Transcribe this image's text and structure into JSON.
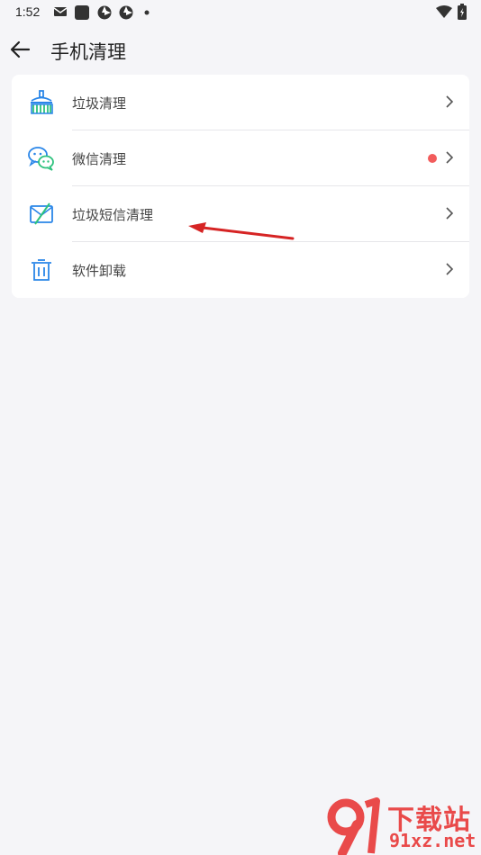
{
  "status_bar": {
    "time": "1:52"
  },
  "header": {
    "title": "手机清理",
    "back_icon": "arrow-left-icon"
  },
  "menu": {
    "items": [
      {
        "label": "垃圾清理",
        "icon": "broom-icon",
        "has_badge": false
      },
      {
        "label": "微信清理",
        "icon": "wechat-icon",
        "has_badge": true
      },
      {
        "label": "垃圾短信清理",
        "icon": "blocked-message-icon",
        "has_badge": false
      },
      {
        "label": "软件卸载",
        "icon": "trash-icon",
        "has_badge": false
      }
    ]
  },
  "colors": {
    "accent_blue": "#2a86e8",
    "accent_green": "#2ec27e",
    "badge_red": "#f25c5c",
    "background": "#f5f5f8",
    "annotation_red": "#d62424"
  },
  "watermark": {
    "line1": "下载站",
    "line2": "91xz.net"
  }
}
